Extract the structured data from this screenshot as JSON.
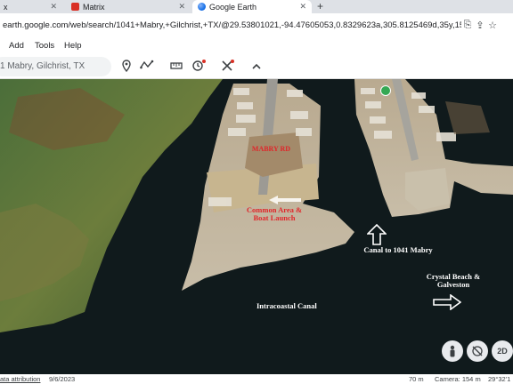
{
  "browser": {
    "tabs": [
      {
        "label": "x"
      },
      {
        "label": "Matrix"
      },
      {
        "label": "Google Earth"
      }
    ],
    "url": "earth.google.com/web/search/1041+Mabry,+Gilchrist,+TX/@29.53801021,-94.47605053,0.8329623a,305.8125469d,35y,151.21172803h,59.9..."
  },
  "menu": {
    "add": "Add",
    "tools": "Tools",
    "help": "Help"
  },
  "search": {
    "value": "1 Mabry, Gilchrist, TX"
  },
  "map": {
    "labels": {
      "mabry_rd": "MABRY RD",
      "common_area": "Common Area & Boat Launch",
      "canal_to": "Canal to 1041 Mabry",
      "crystal_beach": "Crystal Beach & Galveston",
      "intracoastal": "Intracoastal Canal"
    },
    "controls": {
      "mode_2d": "2D"
    }
  },
  "footer": {
    "attribution": "ata attribution",
    "date": "9/6/2023",
    "scale": "70 m",
    "camera": "Camera: 154 m",
    "coords": "29°32'1"
  }
}
